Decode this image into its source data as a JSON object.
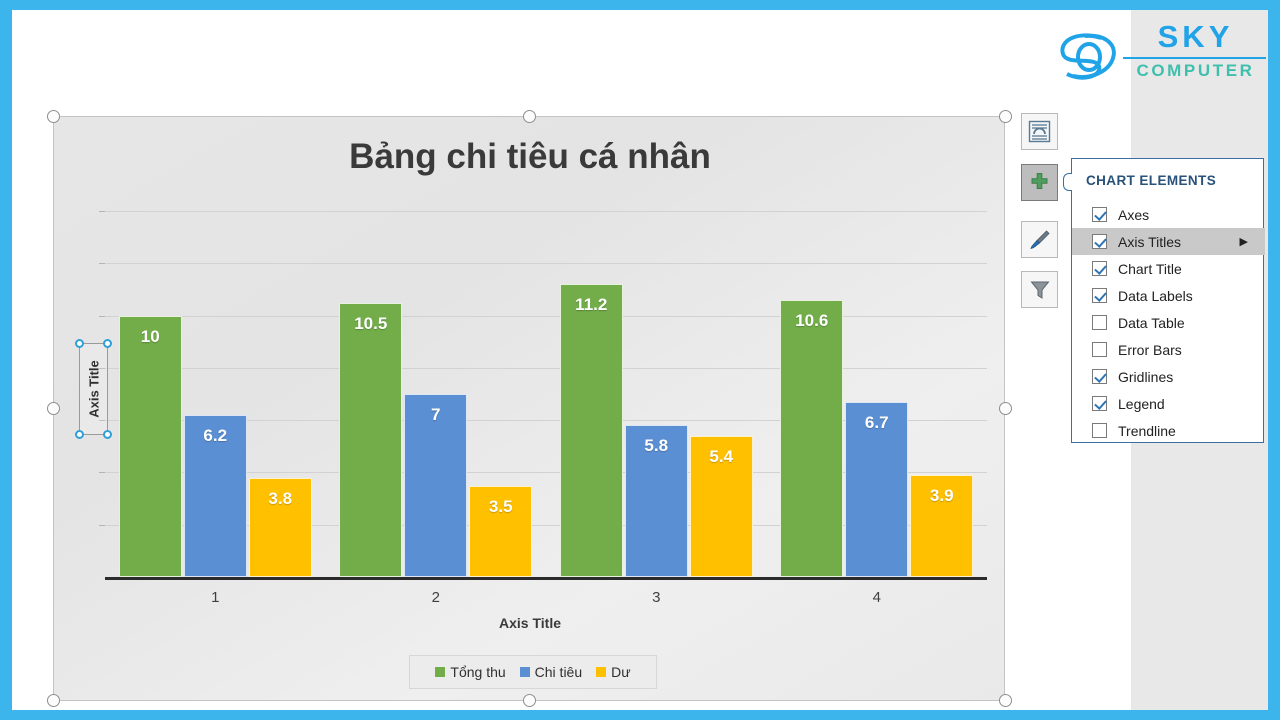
{
  "logo": {
    "primary": "SKY",
    "secondary": "COMPUTER",
    "primary_color": "#21a3e8",
    "secondary_color": "#3fbfae"
  },
  "chart_data": {
    "type": "bar",
    "title": "Bảng chi tiêu cá nhân",
    "xlabel": "Axis Title",
    "ylabel": "Axis Title",
    "categories": [
      "1",
      "2",
      "3",
      "4"
    ],
    "series": [
      {
        "name": "Tổng thu",
        "color": "#72ad4a",
        "values": [
          10,
          10.5,
          11.2,
          10.6
        ]
      },
      {
        "name": "Chi tiêu",
        "color": "#5b8fd4",
        "values": [
          6.2,
          7,
          5.8,
          6.7
        ]
      },
      {
        "name": "Dư",
        "color": "#ffc000",
        "values": [
          3.8,
          3.5,
          5.4,
          3.9
        ]
      }
    ],
    "labels": {
      "Tổng thu": [
        "10",
        "10.5",
        "11.2",
        "10.6"
      ],
      "Chi tiêu": [
        "6.2",
        "7",
        "5.8",
        "6.7"
      ],
      "Dư": [
        "3.8",
        "3.5",
        "5.4",
        "3.9"
      ]
    },
    "ylim": [
      0,
      14
    ],
    "grid": true,
    "y_tick_labels_shown": false,
    "legend_position": "bottom"
  },
  "side_buttons": [
    {
      "name": "chart-layout-options-button",
      "icon": "layout-options-icon",
      "active": false
    },
    {
      "name": "chart-elements-button",
      "icon": "plus-icon",
      "active": true
    },
    {
      "name": "chart-styles-button",
      "icon": "paintbrush-icon",
      "active": false
    },
    {
      "name": "chart-filters-button",
      "icon": "funnel-icon",
      "active": false
    }
  ],
  "chart_elements_panel": {
    "title": "CHART ELEMENTS",
    "items": [
      {
        "label": "Axes",
        "checked": true,
        "selected": false,
        "has_arrow": false
      },
      {
        "label": "Axis Titles",
        "checked": true,
        "selected": true,
        "has_arrow": true
      },
      {
        "label": "Chart Title",
        "checked": true,
        "selected": false,
        "has_arrow": false
      },
      {
        "label": "Data Labels",
        "checked": true,
        "selected": false,
        "has_arrow": false
      },
      {
        "label": "Data Table",
        "checked": false,
        "selected": false,
        "has_arrow": false
      },
      {
        "label": "Error Bars",
        "checked": false,
        "selected": false,
        "has_arrow": false
      },
      {
        "label": "Gridlines",
        "checked": true,
        "selected": false,
        "has_arrow": false
      },
      {
        "label": "Legend",
        "checked": true,
        "selected": false,
        "has_arrow": false
      },
      {
        "label": "Trendline",
        "checked": false,
        "selected": false,
        "has_arrow": false
      }
    ]
  }
}
